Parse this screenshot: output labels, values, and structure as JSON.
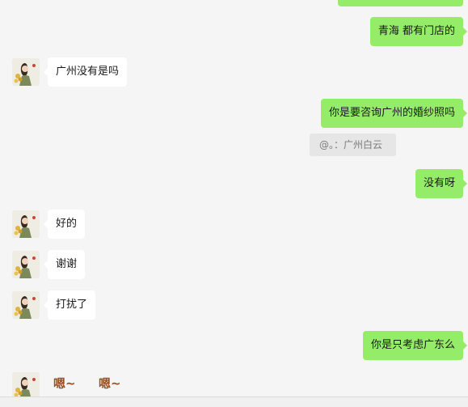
{
  "chat": {
    "messages": [
      {
        "sender": "me",
        "text": "青海 都有门店的"
      },
      {
        "sender": "contact",
        "text": "广州没有是吗"
      },
      {
        "sender": "me",
        "text": "你是要咨询广州的婚纱照吗"
      },
      {
        "sender": "me",
        "text": "没有呀"
      },
      {
        "sender": "contact",
        "text": "好的"
      },
      {
        "sender": "contact",
        "text": "谢谢"
      },
      {
        "sender": "contact",
        "text": "打扰了"
      },
      {
        "sender": "me",
        "text": "你是只考虑广东么"
      }
    ],
    "quote": {
      "text": "@。：广州白云"
    },
    "sticker": {
      "left_text": "嗯~",
      "right_text": "嗯~"
    }
  },
  "colors": {
    "background": "#f5f5f5",
    "outgoing_bubble": "#95ec69",
    "incoming_bubble": "#ffffff",
    "quote_background": "#e6e6e6"
  }
}
